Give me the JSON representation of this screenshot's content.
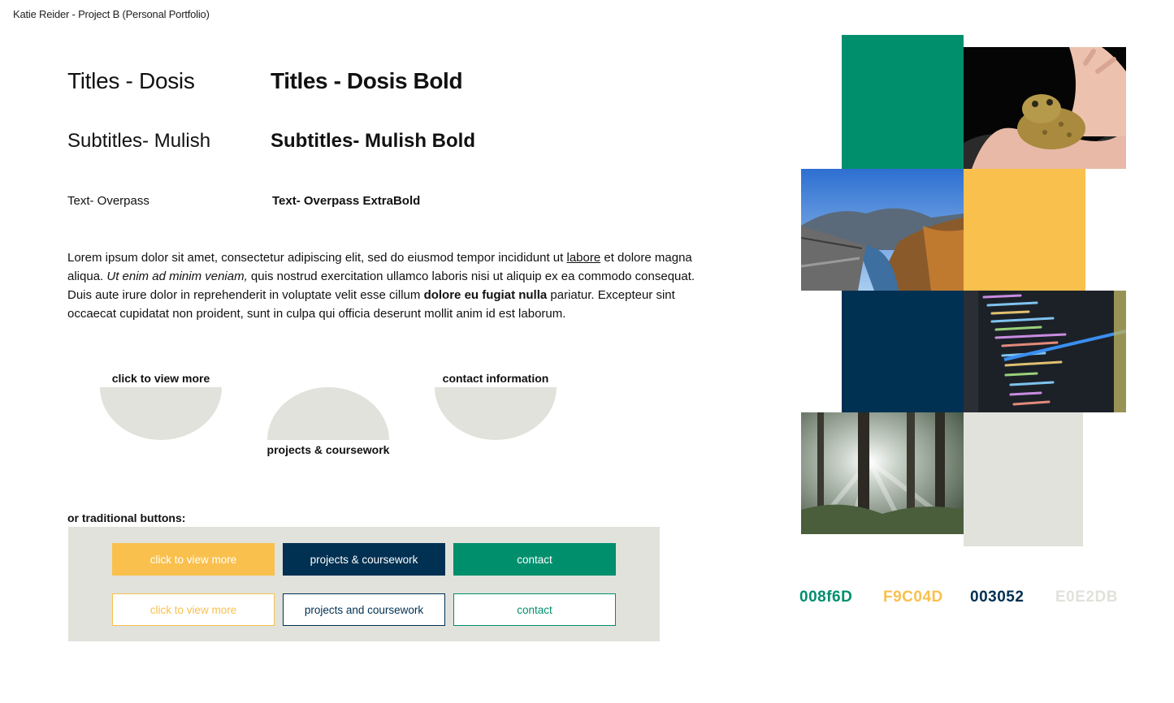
{
  "header": {
    "title": "Katie Reider -  Project B (Personal Portfolio)"
  },
  "typography": {
    "title_regular": "Titles - Dosis",
    "title_bold": "Titles - Dosis Bold",
    "subtitle_regular": "Subtitles- Mulish",
    "subtitle_bold": "Subtitles- Mulish Bold",
    "text_regular": "Text- Overpass",
    "text_bold": "Text- Overpass ExtraBold"
  },
  "paragraph": {
    "part1": "Lorem ipsum dolor sit amet, consectetur adipiscing elit, sed do eiusmod tempor incididunt ut ",
    "underlined": "labore",
    "part2": " et dolore magna aliqua. ",
    "italic": "Ut enim ad minim veniam,",
    "part3": " quis nostrud exercitation ullamco laboris nisi ut aliquip ex ea commodo consequat. Duis aute irure dolor in reprehenderit in voluptate velit esse cillum ",
    "bold": "dolore eu fugiat nulla",
    "part4": " pariatur. Excepteur sint occaecat cupidatat non proident, sunt in culpa qui officia deserunt mollit anim id est laborum."
  },
  "half_circle_buttons": {
    "view_more": "click to view more",
    "projects": "projects & coursework",
    "contact": "contact information"
  },
  "traditional": {
    "label": "or traditional buttons:",
    "row1": [
      "click to view more",
      "projects & coursework",
      "contact"
    ],
    "row2": [
      "click to view more",
      "projects and coursework",
      "contact"
    ]
  },
  "palette": {
    "green": "#008f6d",
    "yellow": "#f9c04d",
    "navy": "#003052",
    "gray": "#e0e2db",
    "labels": [
      "008f6D",
      "F9C04D",
      "003052",
      "E0E2DB"
    ]
  },
  "photos": [
    "toad-in-hand-photo",
    "bridge-river-photo",
    "code-screen-photo",
    "forest-sunlight-photo"
  ]
}
